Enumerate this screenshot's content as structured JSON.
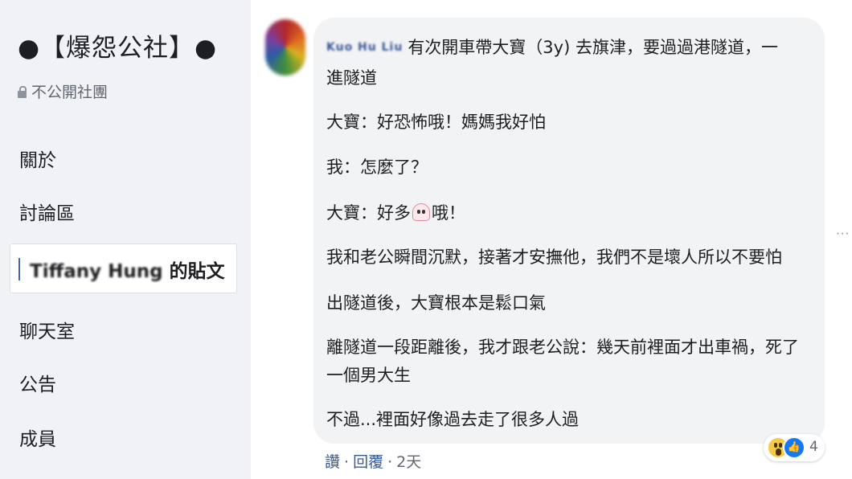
{
  "sidebar": {
    "group_title": "●【爆怨公社】●",
    "privacy": "不公開社團",
    "nav": {
      "about": "關於",
      "discussion": "討論區",
      "member_posts_name": "Tiffany Hung",
      "member_posts_suffix": "的貼文",
      "chat": "聊天室",
      "announcements": "公告",
      "members": "成員"
    }
  },
  "comment": {
    "author": "Kuo Hu Liu",
    "lines": [
      "有次開車帶大寶（3y) 去旗津，要過過港隧道，一",
      "進隧道",
      "大寶：好恐怖哦！媽媽我好怕",
      "我：怎麼了？",
      "大寶：好多",
      "哦！",
      "我和老公瞬間沉默，接著才安撫他，我們不是壞人所以不要怕",
      "出隧道後，大寶根本是鬆口氣",
      "離隧道一段距離後，我才跟老公說：幾天前裡面才出車禍，死了",
      "一個男大生",
      "不過...裡面好像過去走了很多人過"
    ],
    "reaction_count": "4",
    "actions": {
      "like": "讚",
      "reply": "回覆",
      "time": "2天"
    },
    "more": "···"
  },
  "icons": {
    "avatar": "user-avatar",
    "ghost": "ghost-emoji-icon",
    "wow": "wow-reaction-icon",
    "like": "like-reaction-icon",
    "lock": "lock-icon"
  },
  "colors": {
    "link": "#385898",
    "sidebar_bg": "#f0f2f5",
    "bubble_bg": "#f2f3f5",
    "like_blue": "#1877f2"
  }
}
